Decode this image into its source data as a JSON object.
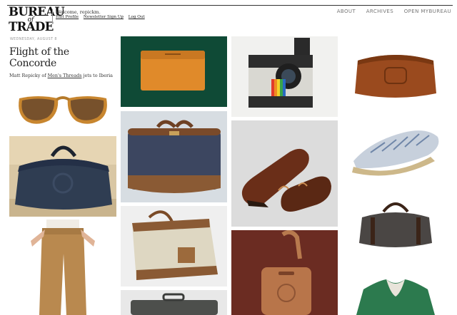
{
  "brand": {
    "line1": "BUREAU",
    "line2": "of",
    "line3": "TRADE"
  },
  "user": {
    "welcome": "Welcome, repickm.",
    "links": [
      "Edit Profile",
      "Newsletter Sign Up",
      "Log Out"
    ]
  },
  "nav": [
    "ABOUT",
    "ARCHIVES",
    "OPEN MYBUREAU"
  ],
  "post": {
    "date": "WEDNESDAY, AUGUST 8",
    "title": "Flight of the Concorde",
    "subtitle_prefix": "Matt Repicky of ",
    "subtitle_link": "Men's Threads",
    "subtitle_suffix": " jets to Iberia"
  },
  "products": [
    {
      "name": "sunglasses",
      "bg": "#ffffff"
    },
    {
      "name": "navy-leather-duffel",
      "bg": "#d9c7a4"
    },
    {
      "name": "khaki-chinos",
      "bg": "#ffffff"
    },
    {
      "name": "orange-leather-card-case",
      "bg": "#0f4a36"
    },
    {
      "name": "navy-canvas-suitcase",
      "bg": "#d7dde2"
    },
    {
      "name": "canvas-tote-bag",
      "bg": "#efefef"
    },
    {
      "name": "grey-hardcase",
      "bg": "#e8e8e8"
    },
    {
      "name": "polaroid-camera",
      "bg": "#f1f1ef"
    },
    {
      "name": "leather-camp-moccasins",
      "bg": "#dcdcdc"
    },
    {
      "name": "leather-luggage-tag",
      "bg": "#6b2c22"
    },
    {
      "name": "leather-dopp-kit",
      "bg": "#ffffff"
    },
    {
      "name": "striped-espadrille",
      "bg": "#ffffff"
    },
    {
      "name": "grey-weekender-duffel",
      "bg": "#ffffff"
    },
    {
      "name": "green-sweatshirt",
      "bg": "#ffffff"
    }
  ]
}
